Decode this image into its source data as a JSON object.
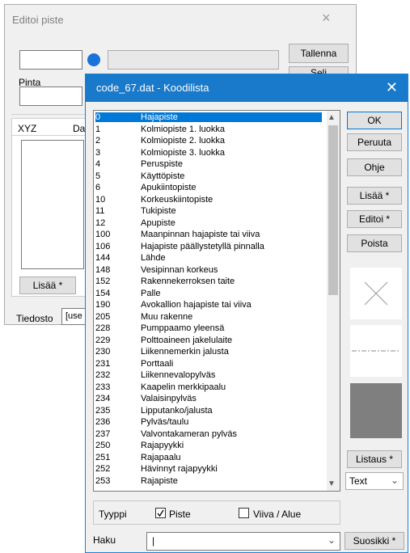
{
  "bg_window": {
    "title": "Editoi piste",
    "close_glyph": "×",
    "save_button": "Tallenna",
    "next_button_partial": "Seli",
    "pinta_label": "Pinta",
    "tabs": [
      "XYZ",
      "Da"
    ],
    "add_button": "Lisää *",
    "tiedosto_label": "Tiedosto",
    "tiedosto_value": "[use"
  },
  "dialog": {
    "title": "code_67.dat - Koodilista",
    "close_glyph": "✕",
    "ok": "OK",
    "cancel": "Peruuta",
    "help": "Ohje",
    "add": "Lisää *",
    "edit": "Editoi *",
    "delete": "Poista",
    "listing": "Listaus *",
    "text_select": "Text",
    "type_label": "Tyyppi",
    "piste_label": "Piste",
    "viiva_label": "Viiva / Alue",
    "search_label": "Haku",
    "search_value": "|",
    "favorites": "Suosikki *",
    "piste_checked": true,
    "viiva_checked": false
  },
  "codes": [
    {
      "code": "0",
      "name": "Hajapiste"
    },
    {
      "code": "1",
      "name": "Kolmiopiste 1. luokka"
    },
    {
      "code": "2",
      "name": "Kolmiopiste 2. luokka"
    },
    {
      "code": "3",
      "name": "Kolmiopiste 3. luokka"
    },
    {
      "code": "4",
      "name": "Peruspiste"
    },
    {
      "code": "5",
      "name": "Käyttöpiste"
    },
    {
      "code": "6",
      "name": "Apukiintopiste"
    },
    {
      "code": "10",
      "name": "Korkeuskiintopiste"
    },
    {
      "code": "11",
      "name": "Tukipiste"
    },
    {
      "code": "12",
      "name": "Apupiste"
    },
    {
      "code": "100",
      "name": "Maanpinnan hajapiste tai viiva"
    },
    {
      "code": "106",
      "name": "Hajapiste päällystetyllä pinnalla"
    },
    {
      "code": "144",
      "name": "Lähde"
    },
    {
      "code": "148",
      "name": "Vesipinnan korkeus"
    },
    {
      "code": "152",
      "name": "Rakennekerroksen taite"
    },
    {
      "code": "154",
      "name": "Palle"
    },
    {
      "code": "190",
      "name": "Avokallion hajapiste tai viiva"
    },
    {
      "code": "205",
      "name": "Muu rakenne"
    },
    {
      "code": "228",
      "name": "Pumppaamo yleensä"
    },
    {
      "code": "229",
      "name": "Polttoaineen jakelulaite"
    },
    {
      "code": "230",
      "name": "Liikennemerkin jalusta"
    },
    {
      "code": "231",
      "name": "Porttaali"
    },
    {
      "code": "232",
      "name": "Liikennevalopylväs"
    },
    {
      "code": "233",
      "name": "Kaapelin merkkipaalu"
    },
    {
      "code": "234",
      "name": "Valaisinpylväs"
    },
    {
      "code": "235",
      "name": "Lipputanko/jalusta"
    },
    {
      "code": "236",
      "name": "Pylväs/taulu"
    },
    {
      "code": "237",
      "name": "Valvontakameran pylväs"
    },
    {
      "code": "250",
      "name": "Rajapyykki"
    },
    {
      "code": "251",
      "name": "Rajapaalu"
    },
    {
      "code": "252",
      "name": "Hävinnyt rajapyykki"
    },
    {
      "code": "253",
      "name": "Rajapiste"
    }
  ],
  "colors": {
    "titlebar": "#1979ca",
    "selection": "#0078d7",
    "blue_dot": "#1a73d9"
  }
}
